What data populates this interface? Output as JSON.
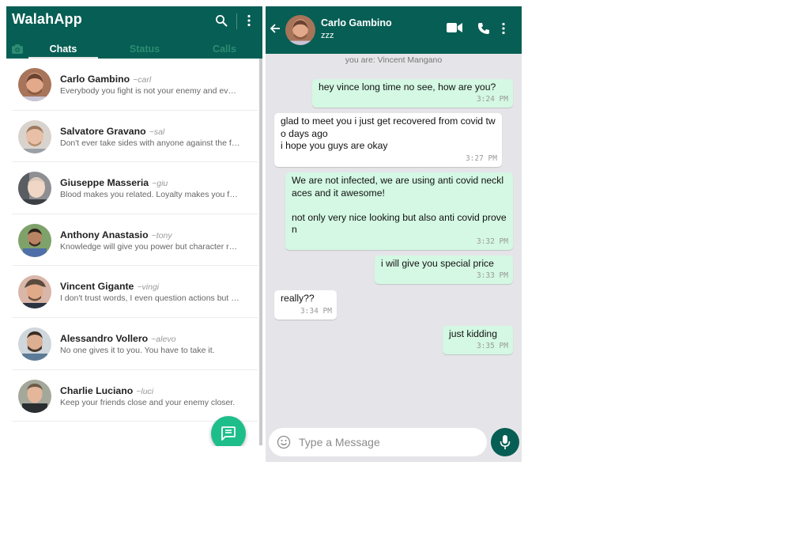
{
  "app": {
    "title": "WalahApp",
    "tabs": [
      {
        "label": "Chats",
        "active": true
      },
      {
        "label": "Status"
      },
      {
        "label": "Calls"
      }
    ],
    "colors": {
      "header": "#075e54",
      "fab": "#1ebe8a",
      "outgoing_bubble": "#d4f8e3",
      "chat_bg": "#e5e5e9"
    }
  },
  "chats": [
    {
      "name": "Carlo Gambino",
      "handle": "~carl",
      "message": "Everybody you fight is not your enemy and everybody who helps you is not your friend."
    },
    {
      "name": "Salvatore Gravano",
      "handle": "~sal",
      "message": "Don't ever take sides with anyone against the family again."
    },
    {
      "name": "Giuseppe Masseria",
      "handle": "~giu",
      "message": "Blood makes you related. Loyalty makes you family."
    },
    {
      "name": "Anthony Anastasio",
      "handle": "~tony",
      "message": "Knowledge will give you power but character respect."
    },
    {
      "name": "Vincent Gigante",
      "handle": "~vingi",
      "message": "I don't trust words, I even question actions but I never doubt patterns."
    },
    {
      "name": "Alessandro Vollero",
      "handle": "~alevo",
      "message": "No one gives it to you. You have to take it."
    },
    {
      "name": "Charlie Luciano",
      "handle": "~luci",
      "message": "Keep your friends close and your enemy closer."
    }
  ],
  "conversation": {
    "contact_name": "Carlo Gambino",
    "contact_status": "zzz",
    "you_are": "you are: Vincent Mangano",
    "messages": [
      {
        "dir": "out",
        "text": "hey vince long time no see, how are you?",
        "time": "3:24 PM"
      },
      {
        "dir": "in",
        "text": "glad to meet you i just get recovered from covid two days ago\ni hope you guys are okay",
        "time": "3:27 PM"
      },
      {
        "dir": "out",
        "text": "We are not infected, we are using anti covid necklaces and it awesome!\n\nnot only very nice looking but also anti covid proven",
        "time": "3:32 PM"
      },
      {
        "dir": "out",
        "text": "i will give you special price",
        "time": "3:33 PM"
      },
      {
        "dir": "in",
        "text": "really??",
        "time": "3:34 PM"
      },
      {
        "dir": "out",
        "text": "just kidding",
        "time": "3:35 PM"
      }
    ],
    "input_placeholder": "Type a Message"
  },
  "icons": {
    "search": "search-icon",
    "menu": "kebab-menu-icon",
    "camera": "camera-icon",
    "back": "arrow-back-icon",
    "video": "video-call-icon",
    "call": "phone-icon",
    "emoji": "emoji-icon",
    "mic": "microphone-icon",
    "new_chat": "new-chat-icon"
  }
}
